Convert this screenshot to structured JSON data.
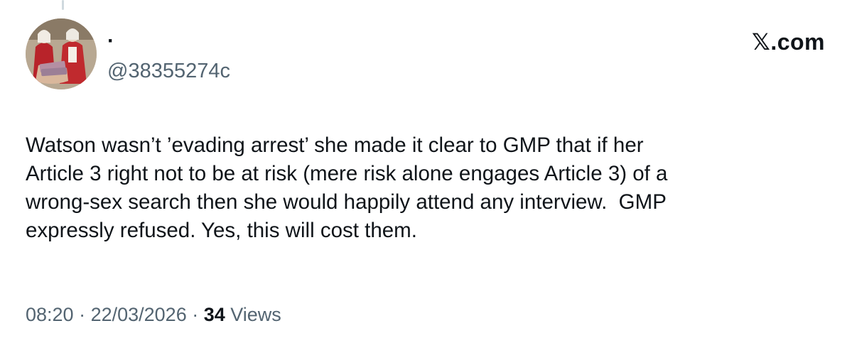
{
  "author": {
    "display_name": "·",
    "handle": "@38355274c",
    "avatar_icon": "profile-photo-avatar"
  },
  "brand": {
    "label": ".com",
    "glyph": "𝕏"
  },
  "tweet": {
    "text": "Watson wasn’t ’evading arrest’ she made it clear to GMP that if her\nArticle 3 right not to be at risk (mere risk alone engages Article 3) of a\nwrong-sex search then she would happily attend any interview.  GMP\nexpressly refused. Yes, this will cost them."
  },
  "meta": {
    "time": "08:20",
    "sep1": " · ",
    "date": "22/03/2026",
    "sep2": " · ",
    "views_count": "34",
    "views_label": " Views"
  },
  "colors": {
    "text_primary": "#0f1419",
    "text_secondary": "#536471",
    "thread_line": "#cfd9de"
  }
}
